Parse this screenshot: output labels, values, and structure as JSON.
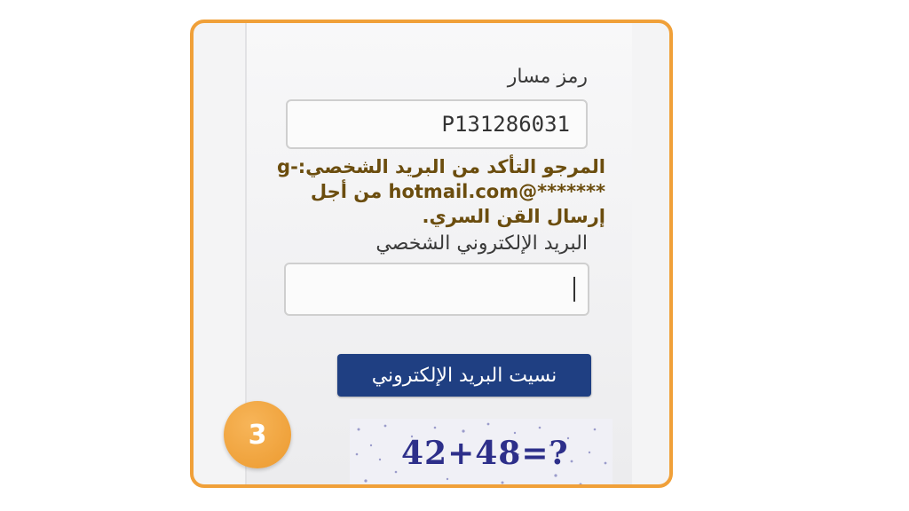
{
  "form": {
    "track_code_label": "رمز مسار",
    "track_code_value": "P131286031",
    "notice_line1": "المرجو التأكد من البريد الشخصي:-g",
    "notice_line2": "*******@hotmail.com من أجل",
    "notice_line3": "إرسال القن السري.",
    "email_label": "البريد الإلكتروني الشخصي",
    "email_value": "",
    "forgot_button_label": "نسيت البريد الإلكتروني",
    "captcha_text": "42+48=?"
  },
  "step_badge": "3",
  "colors": {
    "frame_border": "#f0a039",
    "button_bg": "#1f3f82",
    "notice_text": "#6b4d0e",
    "badge": "#ec9a2f",
    "captcha_text": "#2d2f8a"
  }
}
